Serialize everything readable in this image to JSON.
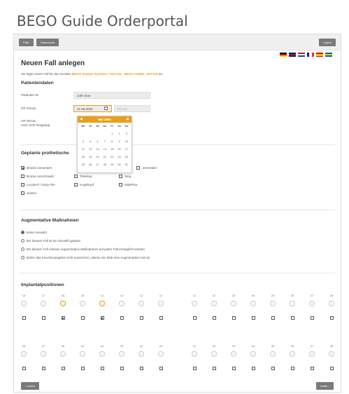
{
  "app_title": "BEGO Guide Orderportal",
  "nav": {
    "faelle": "Fälle",
    "dokumente": "Dokumente",
    "logout": "Logout"
  },
  "flags": [
    "de",
    "gb",
    "nl",
    "fr",
    "es",
    "se"
  ],
  "heading": "Neuen Fall anlegen",
  "intro": {
    "prefix": "Sie legen einen Fall für den Kunden ",
    "customer": "BEGO Implant Systems / Vertrieb - BEGO GUIDE, Vertrieb",
    "suffix": " an."
  },
  "patient": {
    "section": "Patientendaten",
    "id_label": "Patienten-ID",
    "id_value": "John Doe",
    "op_label": "OP-Termin",
    "date_value": "21.05.2020",
    "time_placeholder": "hh:mm",
    "op_note_label": "OP-Termin",
    "op_note_text": "noch nicht festgelegt"
  },
  "calendar": {
    "month": "Mai 2020",
    "weekdays": [
      "Mo",
      "Di",
      "Mi",
      "Do",
      "Fr",
      "Sa",
      "So"
    ],
    "weeks": [
      [
        "",
        "",
        "",
        "",
        "1",
        "2",
        "3"
      ],
      [
        "4",
        "5",
        "6",
        "7",
        "8",
        "9",
        "10"
      ],
      [
        "11",
        "12",
        "13",
        "14",
        "15",
        "16",
        "17"
      ],
      [
        "18",
        "19",
        "20",
        "21",
        "22",
        "23",
        "24"
      ],
      [
        "25",
        "26",
        "27",
        "28",
        "29",
        "30",
        "31"
      ]
    ]
  },
  "prosthetics": {
    "section": "Geplante prothetische",
    "items": [
      {
        "label": "Brücke zementiert",
        "checked": true
      },
      {
        "label": "zementiert",
        "checked": false
      },
      {
        "label": "Brücke verschraubt",
        "checked": false
      },
      {
        "label": "Teleskop",
        "checked": false
      },
      {
        "label": "Steg",
        "checked": false
      },
      {
        "label": "Locator® / Easy-Ten",
        "checked": false
      },
      {
        "label": "Kugelkopf",
        "checked": false
      },
      {
        "label": "MultiPlus",
        "checked": false
      },
      {
        "label": "andere",
        "checked": false
      }
    ]
  },
  "augmentation": {
    "section": "Augmentative Maßnahmen",
    "options": [
      {
        "label": "keine Auswahl",
        "checked": true
      },
      {
        "label": "Bei diesem Fall ist ein Sinuslift geplant",
        "checked": false
      },
      {
        "label": "Bei diesem Fall müssen augmentative Maßnahmen auf jeden Fall ermöglicht werden",
        "checked": false
      },
      {
        "label": "Bohre das Knochenangebot nicht ausreichen, planen Sie bitte eine Augmentation mit ein",
        "checked": false
      }
    ]
  },
  "implants": {
    "section": "Implantatpositionen",
    "upper_left": [
      "18",
      "17",
      "16",
      "15",
      "14",
      "13",
      "12",
      "11"
    ],
    "upper_right": [
      "21",
      "22",
      "23",
      "24",
      "25",
      "26",
      "27",
      "28"
    ],
    "lower_left": [
      "48",
      "47",
      "46",
      "45",
      "44",
      "43",
      "42",
      "41"
    ],
    "lower_right": [
      "31",
      "32",
      "33",
      "34",
      "35",
      "36",
      "37",
      "38"
    ],
    "checked_upper": [
      "16",
      "14"
    ]
  },
  "footer": {
    "back": "‹ zurück",
    "next": "weiter ›"
  },
  "colors": {
    "accent": "#e8a01c",
    "button": "#7a7a7a"
  }
}
